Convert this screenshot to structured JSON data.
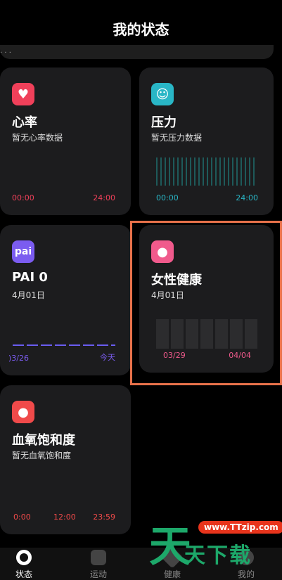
{
  "page_title": "我的状态",
  "heart": {
    "title": "心率",
    "subtitle": "暂无心率数据",
    "axis_start": "00:00",
    "axis_end": "24:00",
    "icon": "heart-icon"
  },
  "pressure": {
    "title": "压力",
    "subtitle": "暂无压力数据",
    "axis_start": "00:00",
    "axis_end": "24:00",
    "icon": "smile-icon"
  },
  "pai": {
    "title": "PAI 0",
    "subtitle": "4月01日",
    "icon_text": "pai",
    "axis_start": ")3/26",
    "axis_end": "今天"
  },
  "female": {
    "title": "女性健康",
    "subtitle": "4月01日",
    "axis_start": "03/29",
    "axis_end": "04/04",
    "icon": "drop-icon"
  },
  "spo2": {
    "title": "血氧饱和度",
    "subtitle": "暂无血氧饱和度",
    "axis_start": "0:00",
    "axis_mid": "12:00",
    "axis_end": "23:59",
    "icon": "blood-drop-icon"
  },
  "nav": {
    "items": [
      "状态",
      "运动",
      "健康",
      "我的"
    ]
  },
  "watermark": {
    "url": "www.TTzip.com",
    "char": "天",
    "text": "天下载"
  },
  "colors": {
    "heart": "#f0405a",
    "pressure": "#29b6c6",
    "pai": "#7b5cf0",
    "female": "#f05a8c",
    "spo2": "#f04a4a",
    "highlight": "#e8714a"
  }
}
